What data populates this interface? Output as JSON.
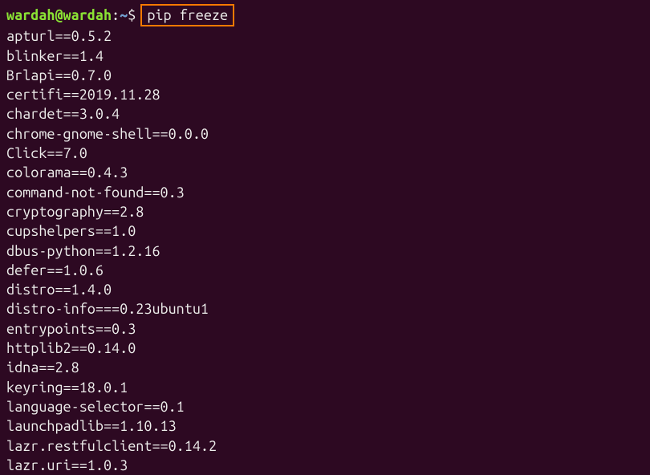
{
  "prompt": {
    "user_host": "wardah@wardah",
    "colon": ":",
    "path": "~",
    "dollar": "$",
    "command": "pip freeze"
  },
  "output": [
    "apturl==0.5.2",
    "blinker==1.4",
    "Brlapi==0.7.0",
    "certifi==2019.11.28",
    "chardet==3.0.4",
    "chrome-gnome-shell==0.0.0",
    "Click==7.0",
    "colorama==0.4.3",
    "command-not-found==0.3",
    "cryptography==2.8",
    "cupshelpers==1.0",
    "dbus-python==1.2.16",
    "defer==1.0.6",
    "distro==1.4.0",
    "distro-info===0.23ubuntu1",
    "entrypoints==0.3",
    "httplib2==0.14.0",
    "idna==2.8",
    "keyring==18.0.1",
    "language-selector==0.1",
    "launchpadlib==1.10.13",
    "lazr.restfulclient==0.14.2",
    "lazr.uri==1.0.3"
  ]
}
